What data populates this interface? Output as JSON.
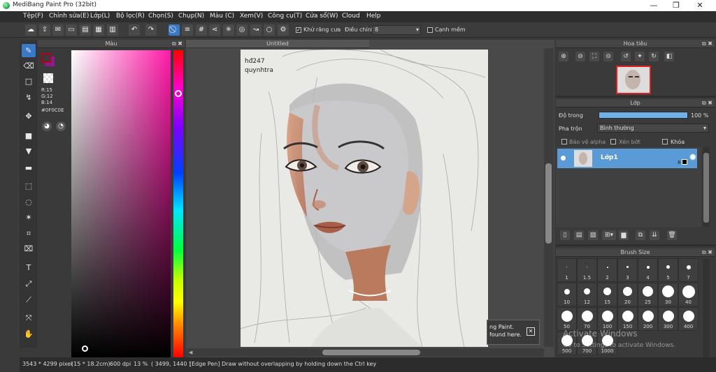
{
  "window": {
    "title": "MediBang Paint Pro (32bit)",
    "minimize": "—",
    "maximize": "❐",
    "close": "✕"
  },
  "menu": [
    "Tệp(F)",
    "Chỉnh sửa(E)",
    "Lớp(L)",
    "Bộ lọc(R)",
    "Chọn(S)",
    "Chụp(N)",
    "Màu (C)",
    "Xem(V)",
    "Công cụ(T)",
    "Cửa sổ(W)",
    "Cloud",
    "Help"
  ],
  "toolbar": {
    "antialias_label": "Khử răng cưa",
    "adjust_label": "Điều chỉnh",
    "adjust_value": "8",
    "sharp_label": "Cạnh mềm"
  },
  "color_panel": {
    "title": "Màu",
    "r": "R:15",
    "g": "G:12",
    "b": "B:14",
    "hex": "#0F0C0E",
    "primary_color": "#b0001a",
    "secondary_color": "#8a1c8e"
  },
  "canvas": {
    "tab": "Untitled",
    "watermark_line1": "hđ247",
    "watermark_line2": "quynhtra"
  },
  "notification": {
    "line1": "ng Paint.",
    "line2": "found here.",
    "close": "✕"
  },
  "navigator": {
    "title": "Hoa tiêu"
  },
  "layers": {
    "title": "Lớp",
    "opacity_label": "Độ trong",
    "opacity_value": "100 %",
    "opacity_fraction": 1.0,
    "blend_label": "Pha trộn",
    "blend_value": "Bình thường",
    "protect_alpha": "Bảo vệ alpha",
    "clipping": "Xén bớt",
    "lock": "Khóa",
    "layer_name": "Lớp1",
    "layer_number": "8"
  },
  "brush_size": {
    "title": "Brush Size",
    "sizes": [
      "1",
      "1.5",
      "2",
      "3",
      "4",
      "5",
      "7",
      "10",
      "12",
      "15",
      "20",
      "25",
      "30",
      "40",
      "50",
      "70",
      "100",
      "150",
      "200",
      "300",
      "400",
      "500",
      "700",
      "1000"
    ]
  },
  "activation": {
    "line1": "Activate Windows",
    "line2": "Go to Settings to activate Windows."
  },
  "status": {
    "size": "3543 * 4299 pixel",
    "cm": "(15 * 18.2cm)",
    "dpi": "600 dpi",
    "zoom": "13 %",
    "coords": "( 3499, 1440 )",
    "tip": "[Edge Pen] Draw without overlapping by holding down the Ctrl key"
  }
}
